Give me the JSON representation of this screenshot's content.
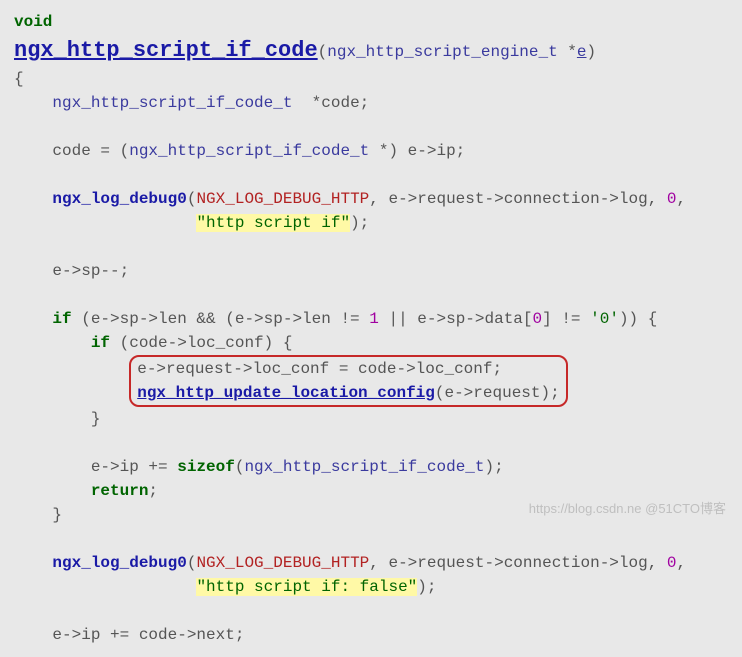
{
  "code": {
    "l1_kw": "void",
    "l2_fn": "ngx_http_script_if_code",
    "l2_p1": "(",
    "l2_type": "ngx_http_script_engine_t",
    "l2_star": " *",
    "l2_param": "e",
    "l2_p2": ")",
    "l3": "{",
    "l4_type": "ngx_http_script_if_code_t",
    "l4_rest": "  *code;",
    "l5_a": "    code = (",
    "l5_type": "ngx_http_script_if_code_t",
    "l5_b": " *) e->ip;",
    "l6_fn": "ngx_log_debug0",
    "l6_p1": "(",
    "l6_macro": "NGX_LOG_DEBUG_HTTP",
    "l6_mid": ", e->request->connection->log, ",
    "l6_num": "0",
    "l6_p2": ",",
    "l7_str": "\"http script if\"",
    "l7_end": ");",
    "l8": "    e->sp--;",
    "l9_kw": "if",
    "l9_a": " (e->sp->len && (e->sp->len != ",
    "l9_n1": "1",
    "l9_b": " || e->sp->data[",
    "l9_n2": "0",
    "l9_c": "] != ",
    "l9_chr": "'0'",
    "l9_d": ")) {",
    "l10_kw": "if",
    "l10_rest": " (code->loc_conf) {",
    "l11": "e->request->loc_conf = code->loc_conf;",
    "l12_fn": "ngx_http_update_location_config",
    "l12_rest": "(e->request);",
    "l13": "        }",
    "l14_a": "        e->ip += ",
    "l14_kw": "sizeof",
    "l14_b": "(",
    "l14_type": "ngx_http_script_if_code_t",
    "l14_c": ");",
    "l15_kw": "return",
    "l15_end": ";",
    "l16": "    }",
    "l17_fn": "ngx_log_debug0",
    "l17_p1": "(",
    "l17_macro": "NGX_LOG_DEBUG_HTTP",
    "l17_mid": ", e->request->connection->log, ",
    "l17_num": "0",
    "l17_p2": ",",
    "l18_str": "\"http script if: false\"",
    "l18_end": ");",
    "l19": "    e->ip += code->next;"
  },
  "watermark": "https://blog.csdn.ne @51CTO博客"
}
